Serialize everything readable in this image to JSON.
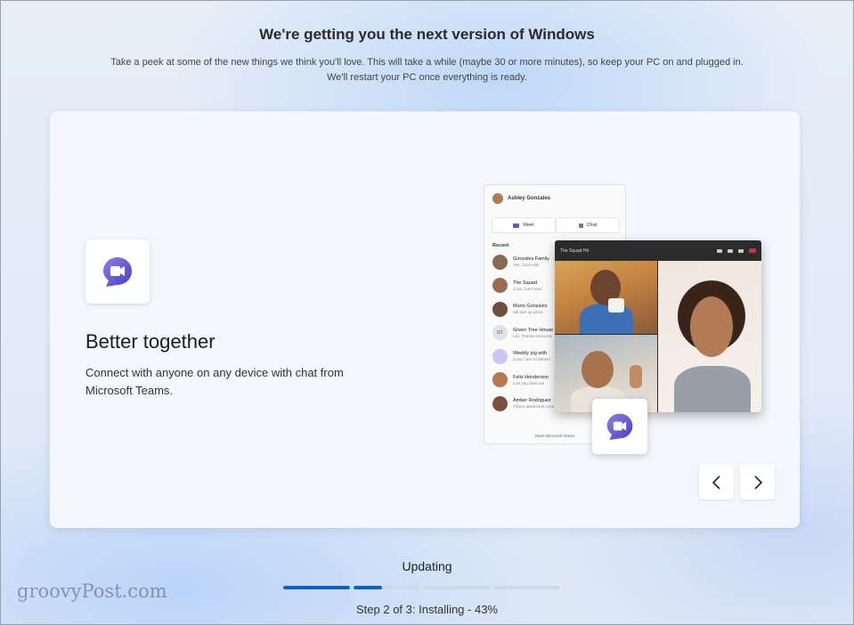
{
  "header": {
    "title": "We're getting you the next version of Windows",
    "subtitle": "Take a peek at some of the new things we think you'll love. This will take a while (maybe 30 or more minutes), so keep your PC on and plugged in. We'll restart your PC once everything is ready."
  },
  "feature": {
    "heading": "Better together",
    "description": "Connect with anyone on any device with chat from Microsoft Teams.",
    "icon": "teams-chat-icon"
  },
  "chat_preview": {
    "user": "Ashley Gonzales",
    "meet_label": "Meet",
    "chat_label": "Chat",
    "recent_label": "Recent",
    "contacts": [
      {
        "name": "Gonzales Family",
        "snippet": "Yes, Can't wait",
        "color": "#8a6a55",
        "initials": ""
      },
      {
        "name": "The Squad",
        "snippet": "Cora: Can't wait",
        "color": "#9a6b4e",
        "initials": ""
      },
      {
        "name": "Mario Gonzales",
        "snippet": "will pick up pizza",
        "color": "#6b4f3c",
        "initials": ""
      },
      {
        "name": "Green Tree House",
        "snippet": "Lilo: Thanks everyone",
        "color": "#dde3ea",
        "initials": "GT"
      },
      {
        "name": "Weekly jog with",
        "snippet": "Cora: I am so behind",
        "color": "#c8c8f0",
        "initials": ""
      },
      {
        "name": "Felix Henderson",
        "snippet": "Can you drive me",
        "color": "#b5784f",
        "initials": ""
      },
      {
        "name": "Amber Rodriguez",
        "snippet": "That is awesome! Love it",
        "color": "#7a5140",
        "initials": ""
      }
    ],
    "open_teams_label": "Open Microsoft Teams",
    "call_title": "The Squad Hit"
  },
  "navigation": {
    "prev_icon": "chevron-left-icon",
    "next_icon": "chevron-right-icon"
  },
  "status": {
    "label": "Updating",
    "step_text": "Step 2 of 3: Installing - 43%",
    "segments": [
      1.0,
      0.43,
      0.0,
      0.0
    ]
  },
  "watermark": "groovyPost.com",
  "colors": {
    "accent": "#1060c0",
    "teams_purple": "#5b5fc7"
  }
}
